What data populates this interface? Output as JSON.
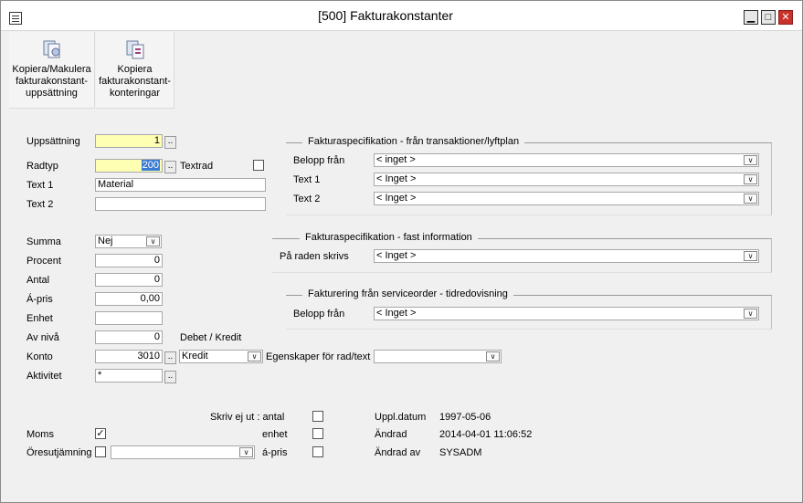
{
  "window": {
    "title": "[500]  Fakturakonstanter",
    "minimize_symbol": "▁",
    "maximize_symbol": "□",
    "close_symbol": "✕"
  },
  "toolbar": {
    "copy_setup_label": "Kopiera/Makulera\nfakturakonstant-\nuppsättning",
    "copy_postings_label": "Kopiera\nfakturakonstant-\nkonteringar"
  },
  "form": {
    "uppsattning": {
      "label": "Uppsättning",
      "value": "1"
    },
    "radtyp": {
      "label": "Radtyp",
      "value": "200"
    },
    "textrad": {
      "label": "Textrad"
    },
    "text1": {
      "label": "Text 1",
      "value": "Material"
    },
    "text2": {
      "label": "Text 2",
      "value": ""
    },
    "summa": {
      "label": "Summa",
      "value": "Nej"
    },
    "procent": {
      "label": "Procent",
      "value": "0"
    },
    "antal": {
      "label": "Antal",
      "value": "0"
    },
    "apris": {
      "label": "Á-pris",
      "value": "0,00"
    },
    "enhet": {
      "label": "Enhet",
      "value": ""
    },
    "avniva": {
      "label": "Av nivå",
      "value": "0"
    },
    "debet_kredit_label": "Debet / Kredit",
    "konto": {
      "label": "Konto",
      "value": "3010",
      "dk_value": "Kredit"
    },
    "egenskaper": {
      "label": "Egenskaper för rad/text",
      "value": ""
    },
    "aktivitet": {
      "label": "Aktivitet",
      "value": "*"
    }
  },
  "group1": {
    "title": "Fakturaspecifikation - från transaktioner/lyftplan",
    "belopp": {
      "label": "Belopp från",
      "value": "< inget >"
    },
    "text1": {
      "label": "Text 1",
      "value": "< Inget >"
    },
    "text2": {
      "label": "Text 2",
      "value": "< Inget >"
    }
  },
  "group2": {
    "title": "Fakturaspecifikation - fast information",
    "paraden": {
      "label": "På raden skrivs",
      "value": "< Inget >"
    }
  },
  "group3": {
    "title": "Fakturering från serviceorder - tidredovisning",
    "belopp": {
      "label": "Belopp från",
      "value": "< Inget >"
    }
  },
  "bottom": {
    "skriv_ej_ut_label": "Skriv ej ut : antal",
    "enhet_label": "enhet",
    "apris_label": "á-pris",
    "moms_label": "Moms",
    "moms_checked": "✓",
    "oresut_label": "Öresutjämning",
    "oresut_value": "",
    "uppl_datum_label": "Uppl.datum",
    "uppl_datum_value": "1997-05-06",
    "andrad_label": "Ändrad",
    "andrad_value": "2014-04-01 11:06:52",
    "andrad_av_label": "Ändrad av",
    "andrad_av_value": "SYSADM"
  },
  "icons": {
    "ellipsis": "..",
    "dropdown": "∨"
  }
}
